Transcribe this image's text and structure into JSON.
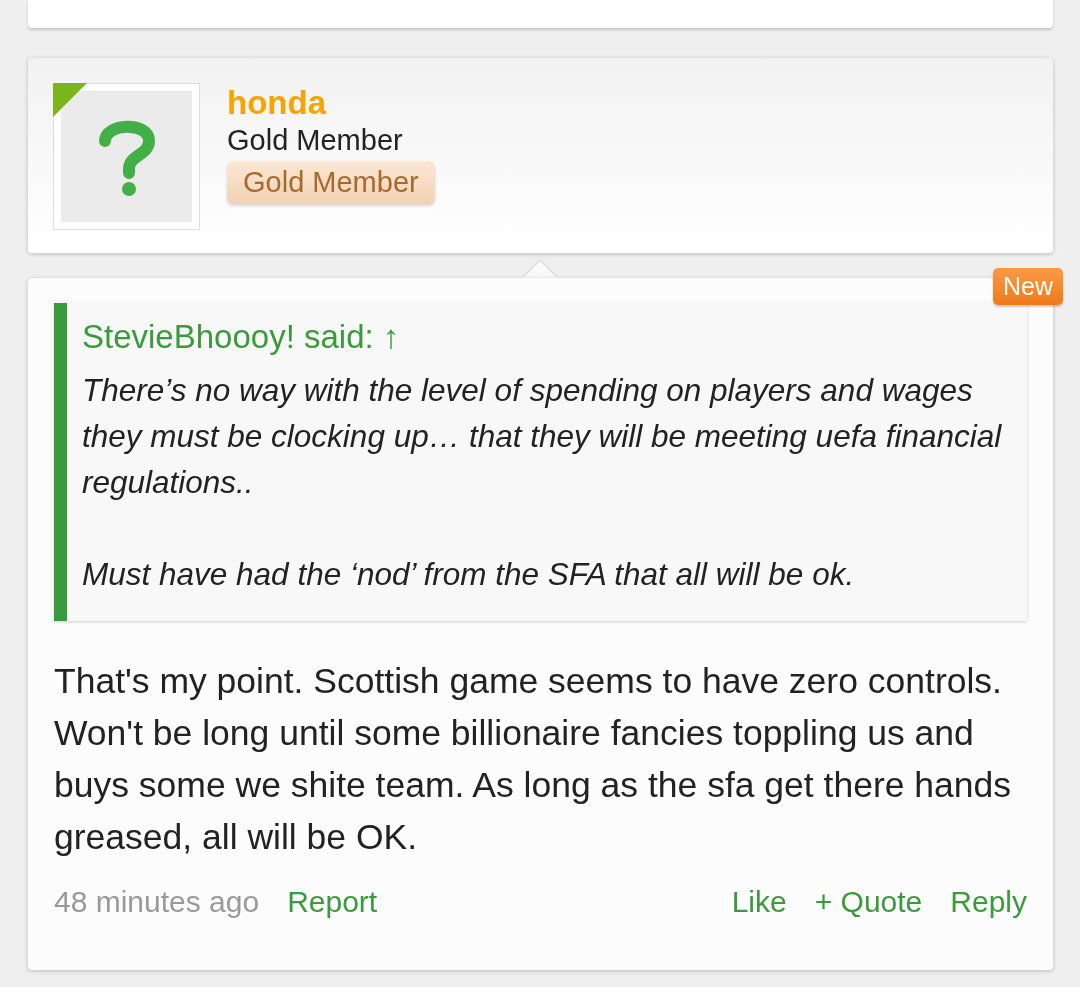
{
  "user": {
    "name": "honda",
    "title": "Gold Member",
    "badge": "Gold Member"
  },
  "new_badge": "New",
  "quote": {
    "author": "StevieBhoooy! said: ↑",
    "paragraphs": [
      "There’s no way with the level of spending on players and wages they must be clocking up… that they will be meeting uefa financial regulations..",
      "Must have had the ‘nod’ from the SFA that all will be ok."
    ]
  },
  "body": "That's my point. Scottish game seems to have zero controls. Won't be long until some billionaire fancies toppling us and buys some we shite team. As long as the sfa get there hands greased, all will be OK.",
  "footer": {
    "time": "48 minutes ago",
    "report": "Report",
    "actions": [
      "Like",
      "+ Quote",
      "Reply"
    ]
  }
}
